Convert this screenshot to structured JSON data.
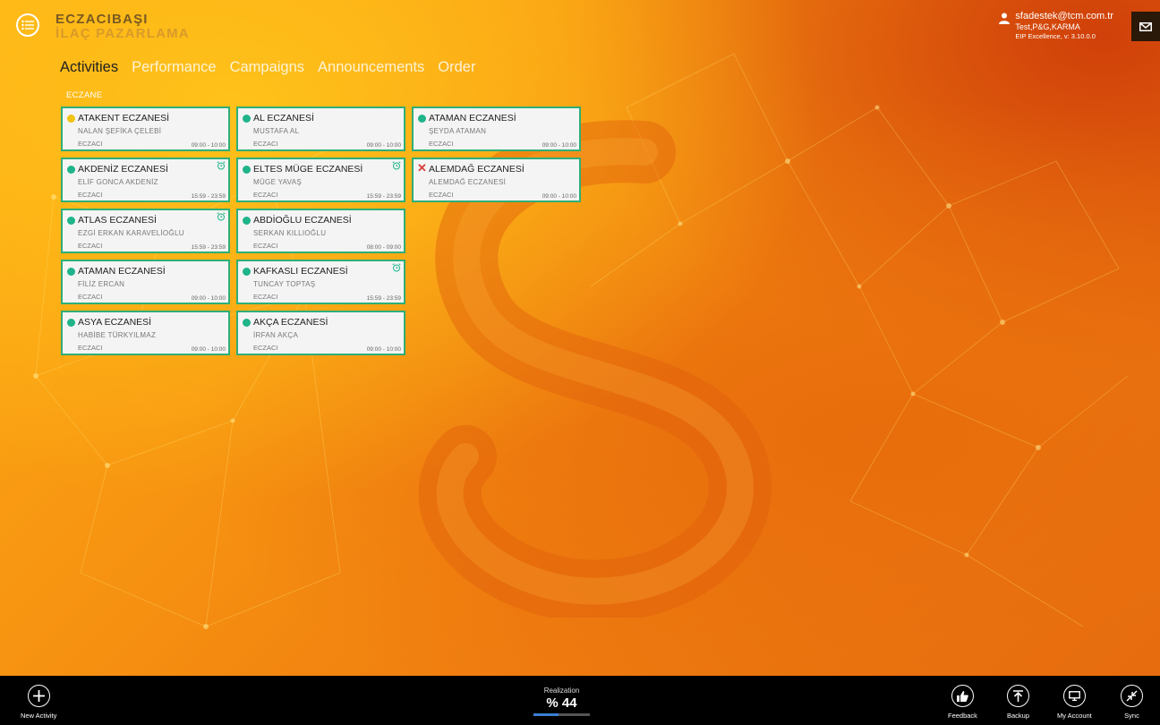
{
  "header": {
    "logo_line1": "ECZACIBAŞI",
    "logo_line2": "İLAÇ PAZARLAMA",
    "user_email": "sfadestek@tcm.com.tr",
    "user_role": "Test,P&G,KARMA",
    "user_version": "EIP Excellence, v: 3.10.0.0"
  },
  "tabs": [
    {
      "label": "Activities",
      "active": true
    },
    {
      "label": "Performance",
      "active": false
    },
    {
      "label": "Campaigns",
      "active": false
    },
    {
      "label": "Announcements",
      "active": false
    },
    {
      "label": "Order",
      "active": false
    }
  ],
  "section_label": "ECZANE",
  "cards": [
    {
      "name": "ATAKENT ECZANESİ",
      "person": "NALAN ŞEFİKA ÇELEBİ",
      "role": "ECZACI",
      "time": "09:00 - 10:00",
      "status": "yellow",
      "alarm": false
    },
    {
      "name": "AKDENİZ ECZANESİ",
      "person": "ELİF GONCA AKDENİZ",
      "role": "ECZACI",
      "time": "15:59 - 23:59",
      "status": "green",
      "alarm": true
    },
    {
      "name": "ATLAS ECZANESİ",
      "person": "EZGİ ERKAN KARAVELİOĞLU",
      "role": "ECZACI",
      "time": "15:59 - 23:59",
      "status": "green",
      "alarm": true
    },
    {
      "name": "ATAMAN ECZANESİ",
      "person": "FİLİZ  ERCAN",
      "role": "ECZACI",
      "time": "09:00 - 10:00",
      "status": "green",
      "alarm": false
    },
    {
      "name": "ASYA ECZANESİ",
      "person": "HABİBE  TÜRKYILMAZ",
      "role": "ECZACI",
      "time": "09:00 - 10:00",
      "status": "green",
      "alarm": false
    },
    {
      "name": "AL ECZANESİ",
      "person": "MUSTAFA  AL",
      "role": "ECZACI",
      "time": "09:00 - 10:00",
      "status": "green",
      "alarm": false
    },
    {
      "name": "ELTES MÜGE ECZANESİ",
      "person": "MÜGE  YAVAŞ",
      "role": "ECZACI",
      "time": "15:59 - 23:59",
      "status": "green",
      "alarm": true
    },
    {
      "name": "ABDİOĞLU ECZANESİ",
      "person": "SERKAN  KILLIOĞLU",
      "role": "ECZACI",
      "time": "08:00 - 09:00",
      "status": "green",
      "alarm": false
    },
    {
      "name": "KAFKASLI ECZANESİ",
      "person": "TUNCAY  TOPTAŞ",
      "role": "ECZACI",
      "time": "15:59 - 23:59",
      "status": "green",
      "alarm": true
    },
    {
      "name": "AKÇA ECZANESİ",
      "person": "İRFAN  AKÇA",
      "role": "ECZACI",
      "time": "09:00 - 10:00",
      "status": "green",
      "alarm": false
    },
    {
      "name": "ATAMAN ECZANESİ",
      "person": "ŞEYDA  ATAMAN",
      "role": "ECZACI",
      "time": "09:00 - 10:00",
      "status": "green",
      "alarm": false
    },
    {
      "name": "ALEMDAĞ ECZANESİ",
      "person": "ALEMDAĞ ECZANESİ",
      "role": "ECZACI",
      "time": "09:00 - 10:00",
      "status": "cancelled",
      "alarm": false
    }
  ],
  "bottombar": {
    "new_activity": "New Activity",
    "realization_label": "Realization",
    "realization_value": "% 44",
    "realization_fraction": 0.44,
    "feedback": "Feedback",
    "backup": "Backup",
    "my_account": "My Account",
    "sync": "Sync"
  },
  "colors": {
    "status_green": "#1fb48a",
    "status_yellow": "#f2c311",
    "status_cancelled": "#d9403a",
    "card_border": "#2fae78"
  }
}
